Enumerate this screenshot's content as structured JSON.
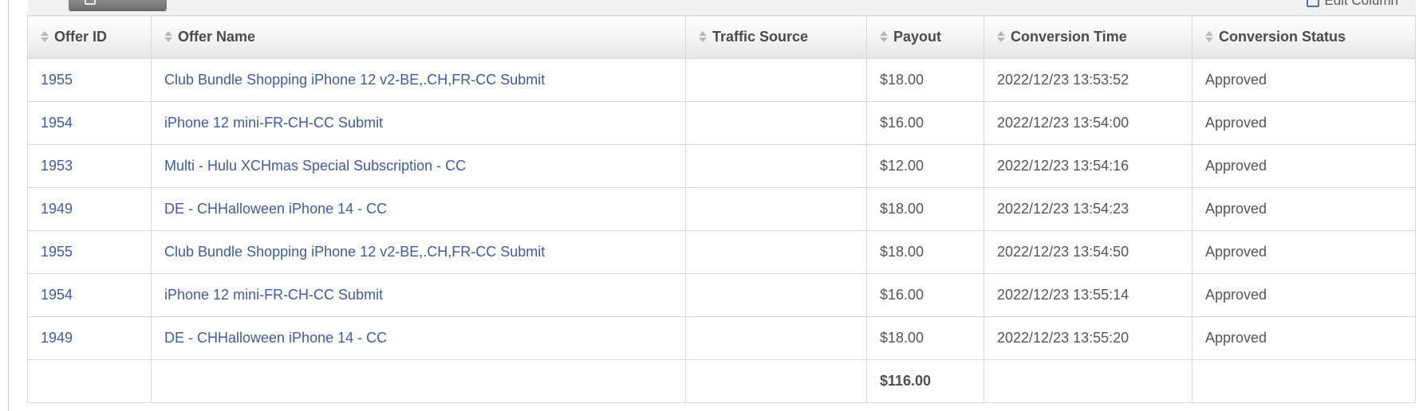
{
  "toolbar": {
    "edit_column_label": "Edit Column"
  },
  "table": {
    "columns": [
      "Offer ID",
      "Offer Name",
      "Traffic Source",
      "Payout",
      "Conversion Time",
      "Conversion Status"
    ],
    "rows": [
      {
        "offer_id": "1955",
        "offer_name": "Club Bundle Shopping iPhone 12 v2-BE,.CH,FR-CC Submit",
        "traffic_source": "",
        "payout": "$18.00",
        "conversion_time": "2022/12/23 13:53:52",
        "status": "Approved"
      },
      {
        "offer_id": "1954",
        "offer_name": "iPhone 12 mini-FR-CH-CC Submit",
        "traffic_source": "",
        "payout": "$16.00",
        "conversion_time": "2022/12/23 13:54:00",
        "status": "Approved"
      },
      {
        "offer_id": "1953",
        "offer_name": "Multi - Hulu XCHmas Special Subscription - CC",
        "traffic_source": "",
        "payout": "$12.00",
        "conversion_time": "2022/12/23 13:54:16",
        "status": "Approved"
      },
      {
        "offer_id": "1949",
        "offer_name": "DE - CHHalloween iPhone 14 - CC",
        "traffic_source": "",
        "payout": "$18.00",
        "conversion_time": "2022/12/23 13:54:23",
        "status": "Approved"
      },
      {
        "offer_id": "1955",
        "offer_name": "Club Bundle Shopping iPhone 12 v2-BE,.CH,FR-CC Submit",
        "traffic_source": "",
        "payout": "$18.00",
        "conversion_time": "2022/12/23 13:54:50",
        "status": "Approved"
      },
      {
        "offer_id": "1954",
        "offer_name": "iPhone 12 mini-FR-CH-CC Submit",
        "traffic_source": "",
        "payout": "$16.00",
        "conversion_time": "2022/12/23 13:55:14",
        "status": "Approved"
      },
      {
        "offer_id": "1949",
        "offer_name": "DE - CHHalloween iPhone 14 - CC",
        "traffic_source": "",
        "payout": "$18.00",
        "conversion_time": "2022/12/23 13:55:20",
        "status": "Approved"
      }
    ],
    "total_payout": "$116.00"
  }
}
